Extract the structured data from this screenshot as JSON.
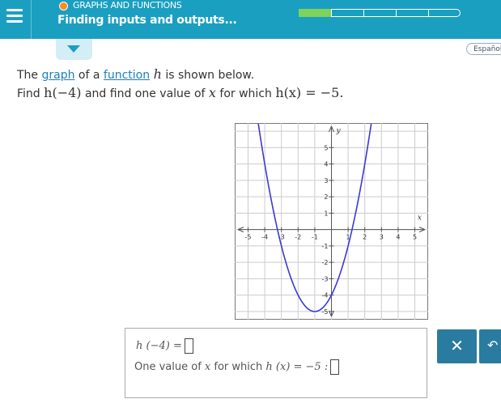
{
  "header": {
    "topic": "GRAPHS AND FUNCTIONS",
    "title": "Finding inputs and outputs...",
    "progress": {
      "completed": 1,
      "total": 5
    },
    "language_button": "Español"
  },
  "question": {
    "line1": {
      "pre": "The ",
      "link1": "graph",
      "mid": " of a ",
      "link2": "function",
      "post1": " ",
      "var": "h",
      "post2": " is shown below."
    },
    "line2": {
      "pre": "Find ",
      "expr1": "h(−4)",
      "mid": " and find one value of ",
      "var": "x",
      "post": " for which ",
      "expr2": "h(x) = −5."
    }
  },
  "chart_data": {
    "type": "line",
    "function": "h(x) = (x + 1)^2 - 5",
    "x": [
      -4.8,
      -4,
      -3,
      -2,
      -1,
      0,
      1,
      2,
      2.8
    ],
    "y": [
      9.44,
      4,
      -1,
      -4,
      -5,
      -4,
      -1,
      4,
      9.44
    ],
    "xlim": [
      -5.8,
      5.8
    ],
    "ylim": [
      -5.5,
      6.5
    ],
    "xlabel": "x",
    "ylabel": "y",
    "x_ticks": [
      "-5",
      "-4",
      "-3",
      "-2",
      "-1",
      "1",
      "2",
      "3",
      "4",
      "5"
    ],
    "y_ticks": [
      "5",
      "4",
      "3",
      "2",
      "1",
      "-1",
      "-2",
      "-3",
      "-4",
      "-5"
    ],
    "grid": true,
    "color": "#3a3ad6"
  },
  "answer": {
    "line1_expr": "h (−4)  =",
    "line2_pre": "One value of ",
    "line2_var": "x",
    "line2_mid": " for which ",
    "line2_expr": "h (x)  =  −5 :"
  },
  "buttons": {
    "clear": "✕",
    "undo": "↶"
  }
}
